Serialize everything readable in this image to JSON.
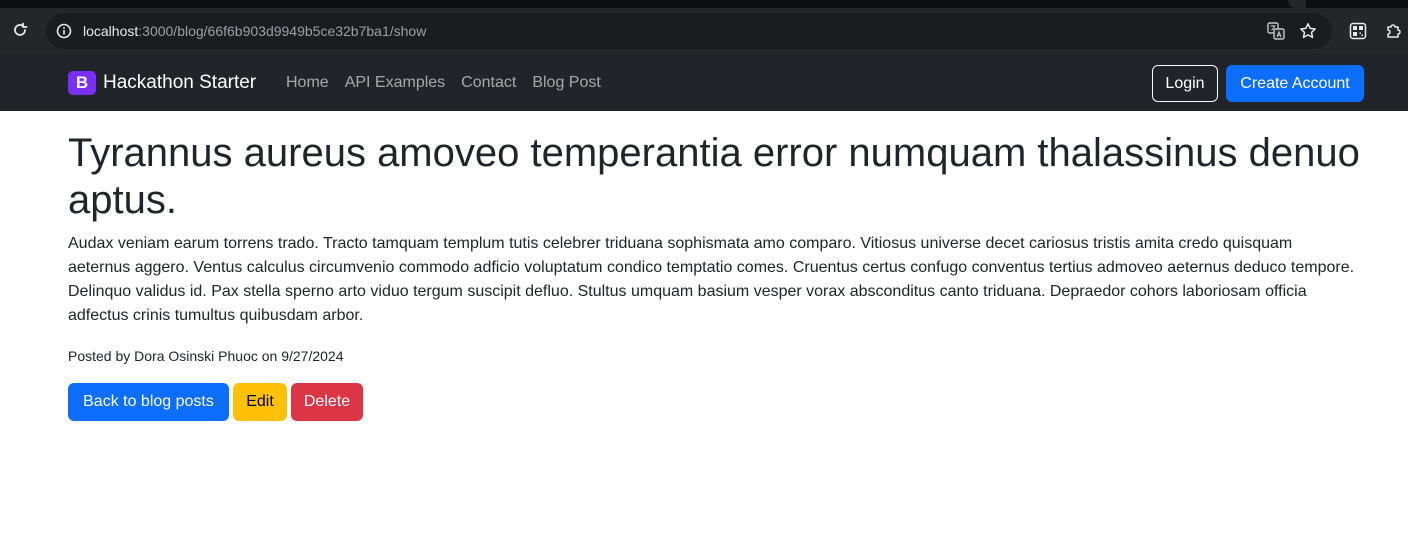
{
  "browser": {
    "url_host": "localhost",
    "url_path": ":3000/blog/66f6b903d9949b5ce32b7ba1/show"
  },
  "navbar": {
    "brand_letter": "B",
    "brand_name": "Hackathon Starter",
    "links": [
      "Home",
      "API Examples",
      "Contact",
      "Blog Post"
    ],
    "login_label": "Login",
    "create_account_label": "Create Account"
  },
  "post": {
    "title": "Tyrannus aureus amoveo temperantia error numquam thalassinus denuo aptus.",
    "body": "Audax veniam earum torrens trado. Tracto tamquam templum tutis celebrer triduana sophismata amo comparo. Vitiosus universe decet cariosus tristis amita credo quisquam aeternus aggero. Ventus calculus circumvenio commodo adficio voluptatum condico temptatio comes. Cruentus certus confugo conventus tertius admoveo aeternus deduco tempore. Delinquo validus id. Pax stella sperno arto viduo tergum suscipit defluo. Stultus umquam basium vesper vorax absconditus canto triduana. Depraedor cohors laboriosam officia adfectus crinis tumultus quibusdam arbor.",
    "meta": "Posted by Dora Osinski Phuoc on 9/27/2024"
  },
  "actions": {
    "back_label": "Back to blog posts",
    "edit_label": "Edit",
    "delete_label": "Delete"
  },
  "colors": {
    "navbar_bg": "#212529",
    "brand_purple": "#7a2ff7",
    "primary": "#0d6efd",
    "warning": "#ffc107",
    "danger": "#dc3545"
  }
}
